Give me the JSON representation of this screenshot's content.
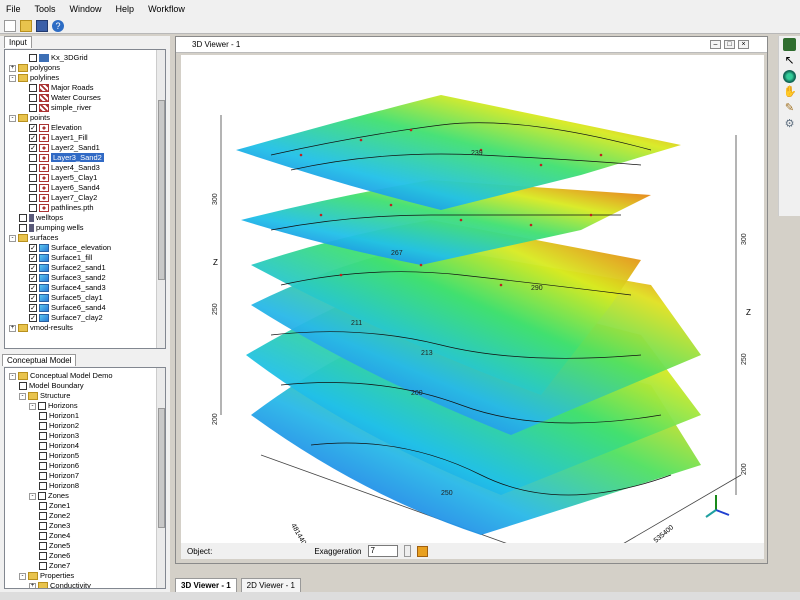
{
  "menu": {
    "items": [
      "File",
      "Tools",
      "Window",
      "Help",
      "Workflow"
    ]
  },
  "input_panel": {
    "tab": "Input",
    "items": [
      {
        "label": "Kx_3DGrid",
        "type": "grid",
        "indent": 2,
        "checked": false
      },
      {
        "label": "polygons",
        "type": "folder",
        "indent": 0,
        "expand": "+"
      },
      {
        "label": "polylines",
        "type": "folder",
        "indent": 0,
        "expand": "-"
      },
      {
        "label": "Major Roads",
        "type": "lines",
        "indent": 2,
        "checked": false
      },
      {
        "label": "Water Courses",
        "type": "lines",
        "indent": 2,
        "checked": false
      },
      {
        "label": "simple_river",
        "type": "lines",
        "indent": 2,
        "checked": false
      },
      {
        "label": "points",
        "type": "folder",
        "indent": 0,
        "expand": "-"
      },
      {
        "label": "Elevation",
        "type": "pts",
        "indent": 2,
        "checked": true
      },
      {
        "label": "Layer1_Fill",
        "type": "pts",
        "indent": 2,
        "checked": true
      },
      {
        "label": "Layer2_Sand1",
        "type": "pts",
        "indent": 2,
        "checked": true
      },
      {
        "label": "Layer3_Sand2",
        "type": "pts",
        "indent": 2,
        "checked": false,
        "selected": true
      },
      {
        "label": "Layer4_Sand3",
        "type": "pts",
        "indent": 2,
        "checked": false
      },
      {
        "label": "Layer5_Clay1",
        "type": "pts",
        "indent": 2,
        "checked": false
      },
      {
        "label": "Layer6_Sand4",
        "type": "pts",
        "indent": 2,
        "checked": false
      },
      {
        "label": "Layer7_Clay2",
        "type": "pts",
        "indent": 2,
        "checked": false
      },
      {
        "label": "pathlines.pth",
        "type": "pts",
        "indent": 2,
        "checked": false
      },
      {
        "label": "welltops",
        "type": "well",
        "indent": 1,
        "checked": false
      },
      {
        "label": "pumping wells",
        "type": "well",
        "indent": 1,
        "checked": false
      },
      {
        "label": "surfaces",
        "type": "folder",
        "indent": 0,
        "expand": "-"
      },
      {
        "label": "Surface_elevation",
        "type": "surf",
        "indent": 2,
        "checked": true
      },
      {
        "label": "Surface1_fill",
        "type": "surf",
        "indent": 2,
        "checked": true
      },
      {
        "label": "Surface2_sand1",
        "type": "surf",
        "indent": 2,
        "checked": true
      },
      {
        "label": "Surface3_sand2",
        "type": "surf",
        "indent": 2,
        "checked": true
      },
      {
        "label": "Surface4_sand3",
        "type": "surf",
        "indent": 2,
        "checked": true
      },
      {
        "label": "Surface5_clay1",
        "type": "surf",
        "indent": 2,
        "checked": true
      },
      {
        "label": "Surface6_sand4",
        "type": "surf",
        "indent": 2,
        "checked": true
      },
      {
        "label": "Surface7_clay2",
        "type": "surf",
        "indent": 2,
        "checked": true
      },
      {
        "label": "vmod-results",
        "type": "folder",
        "indent": 0,
        "expand": "+"
      }
    ]
  },
  "model_panel": {
    "tab": "Conceptual Model",
    "items": [
      {
        "label": "Conceptual Model Demo",
        "type": "folder",
        "indent": 0,
        "expand": "-"
      },
      {
        "label": "Model Boundary",
        "type": "box",
        "indent": 1
      },
      {
        "label": "Structure",
        "type": "folder",
        "indent": 1,
        "expand": "-"
      },
      {
        "label": "Horizons",
        "type": "box",
        "indent": 2,
        "expand": "-"
      },
      {
        "label": "Horizon1",
        "type": "box",
        "indent": 3
      },
      {
        "label": "Horizon2",
        "type": "box",
        "indent": 3
      },
      {
        "label": "Horizon3",
        "type": "box",
        "indent": 3
      },
      {
        "label": "Horizon4",
        "type": "box",
        "indent": 3
      },
      {
        "label": "Horizon5",
        "type": "box",
        "indent": 3
      },
      {
        "label": "Horizon6",
        "type": "box",
        "indent": 3
      },
      {
        "label": "Horizon7",
        "type": "box",
        "indent": 3
      },
      {
        "label": "Horizon8",
        "type": "box",
        "indent": 3
      },
      {
        "label": "Zones",
        "type": "box",
        "indent": 2,
        "expand": "-"
      },
      {
        "label": "Zone1",
        "type": "box",
        "indent": 3
      },
      {
        "label": "Zone2",
        "type": "box",
        "indent": 3
      },
      {
        "label": "Zone3",
        "type": "box",
        "indent": 3
      },
      {
        "label": "Zone4",
        "type": "box",
        "indent": 3
      },
      {
        "label": "Zone5",
        "type": "box",
        "indent": 3
      },
      {
        "label": "Zone6",
        "type": "box",
        "indent": 3
      },
      {
        "label": "Zone7",
        "type": "box",
        "indent": 3
      },
      {
        "label": "Properties",
        "type": "folder",
        "indent": 1,
        "expand": "-"
      },
      {
        "label": "Conductivity",
        "type": "folder",
        "indent": 2,
        "expand": "+"
      }
    ]
  },
  "viewer": {
    "title": "3D Viewer - 1",
    "object_label": "Object:",
    "exaggeration_label": "Exaggeration",
    "exaggeration_value": "7",
    "axis_labels": {
      "z_left": "Z",
      "z_right": "Z",
      "x": "4814400",
      "y": "535400"
    },
    "left_ticks": [
      "300",
      "250",
      "200"
    ],
    "right_ticks": [
      "300",
      "250",
      "200"
    ],
    "contour_labels": [
      "239",
      "267",
      "290",
      "211",
      "213",
      "200",
      "250"
    ]
  },
  "bottom_tabs": [
    "3D Viewer - 1",
    "2D Viewer - 1"
  ]
}
